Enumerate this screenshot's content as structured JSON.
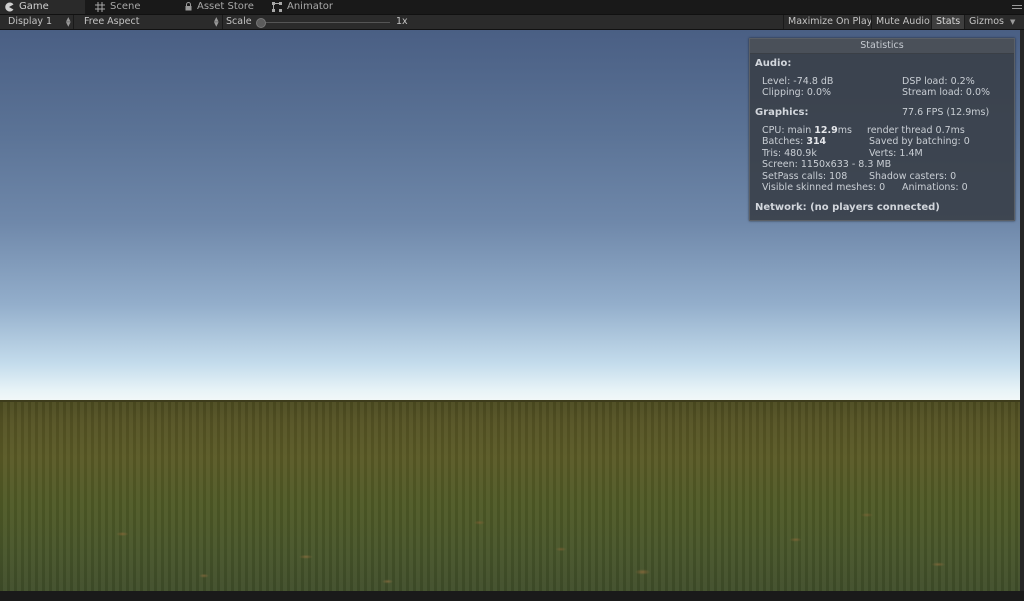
{
  "tabs": [
    {
      "label": "Game",
      "icon": "pacman-icon",
      "active": true
    },
    {
      "label": "Scene",
      "icon": "grid-icon",
      "active": false
    },
    {
      "label": "Asset Store",
      "icon": "lock-icon",
      "active": false
    },
    {
      "label": "Animator",
      "icon": "animator-icon",
      "active": false
    }
  ],
  "toolbar": {
    "display": "Display 1",
    "aspect": "Free Aspect",
    "scale_label": "Scale",
    "scale_value": "1x",
    "scale_fraction": 0.0,
    "maximize": "Maximize On Play",
    "mute": "Mute Audio",
    "stats": "Stats",
    "gizmos": "Gizmos"
  },
  "stats": {
    "title": "Statistics",
    "audio_head": "Audio:",
    "level": "Level: -74.8 dB",
    "dsp": "DSP load: 0.2%",
    "clipping": "Clipping: 0.0%",
    "stream": "Stream load: 0.0%",
    "graphics_head": "Graphics:",
    "fps": "77.6 FPS (12.9ms)",
    "cpu_prefix": "CPU: main ",
    "cpu_main": "12.9",
    "cpu_suffix": "ms",
    "render_thread": "render thread 0.7ms",
    "batches_prefix": "Batches: ",
    "batches": "314",
    "saved_batching": "Saved by batching: 0",
    "tris": "Tris: 480.9k",
    "verts": "Verts: 1.4M",
    "screen": "Screen: 1150x633 - 8.3 MB",
    "setpass": "SetPass calls: 108",
    "shadow": "Shadow casters: 0",
    "skinned": "Visible skinned meshes: 0",
    "animations": "Animations: 0",
    "network": "Network: (no players connected)"
  },
  "colors": {
    "editor_bg": "#1b1b1b",
    "toolbar_bg": "#2b2b2b",
    "sky_top": "#4a5f84",
    "sky_horizon": "#f2f8f8",
    "ground": "#565424",
    "stats_panel": "#3a404a"
  }
}
